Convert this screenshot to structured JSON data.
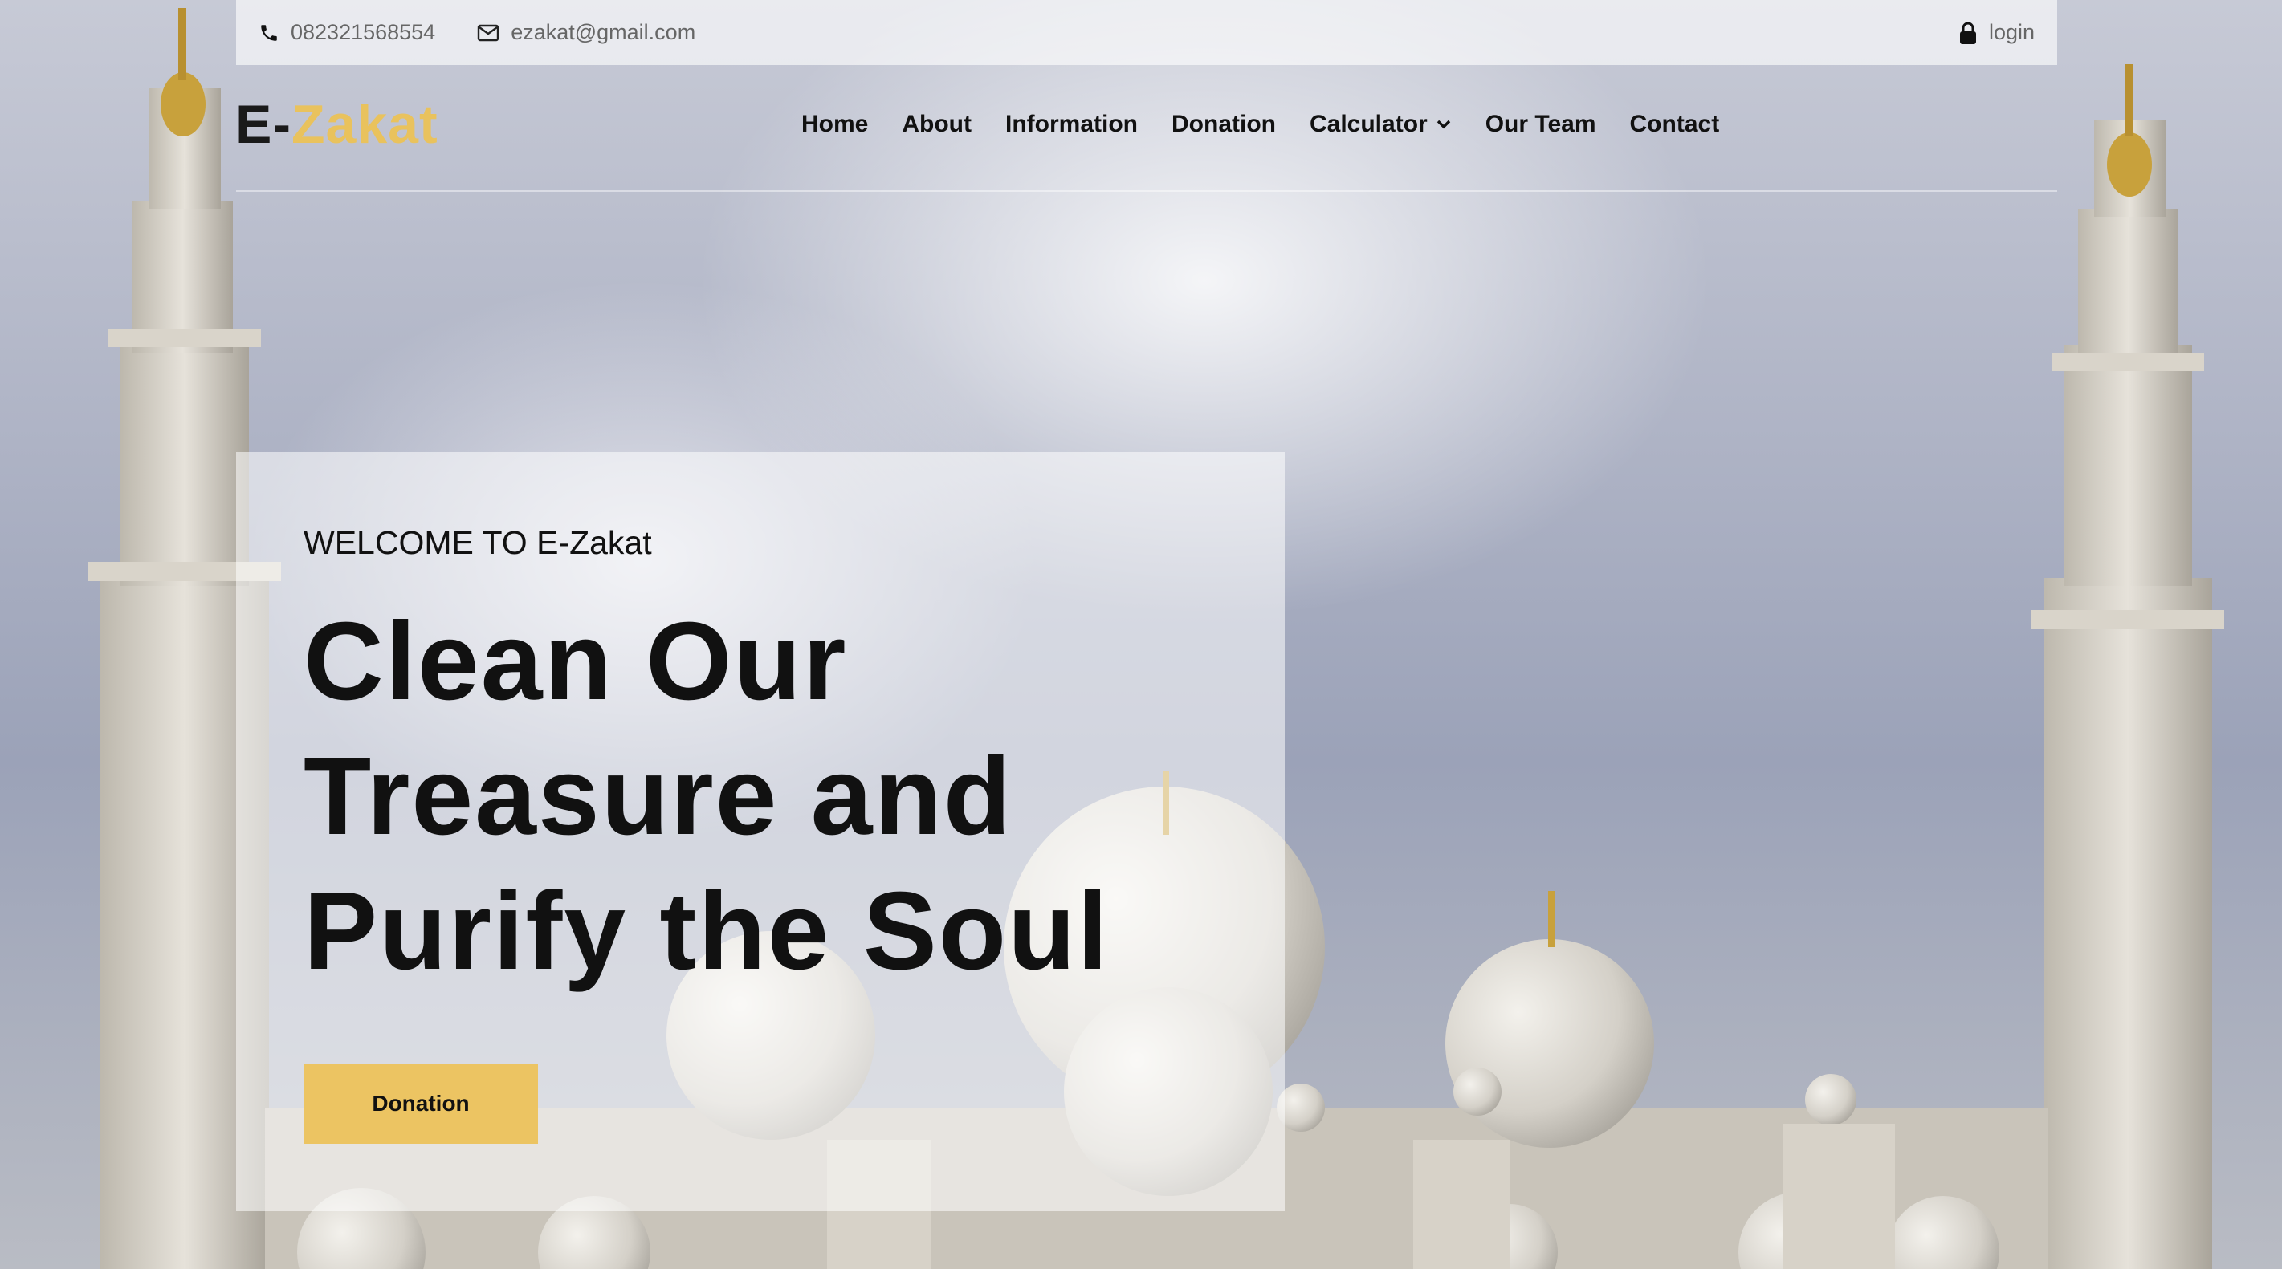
{
  "topbar": {
    "phone": "082321568554",
    "email": "ezakat@gmail.com",
    "login": "login",
    "icons": [
      "phone-icon",
      "envelope-icon",
      "lock-icon"
    ]
  },
  "brand": {
    "prefix": "E-",
    "name": "Zakat",
    "accent_color": "#e9c25d"
  },
  "nav": {
    "items": [
      {
        "label": "Home"
      },
      {
        "label": "About"
      },
      {
        "label": "Information"
      },
      {
        "label": "Donation"
      },
      {
        "label": "Calculator",
        "icon": "chevron-down-icon"
      },
      {
        "label": "Our Team"
      },
      {
        "label": "Contact"
      }
    ]
  },
  "hero": {
    "welcome": "WELCOME TO E-Zakat",
    "headline_lines": [
      "Clean Our",
      "Treasure and",
      "Purify the Soul"
    ],
    "button_label": "Donation",
    "button_color": "#ecc462"
  }
}
